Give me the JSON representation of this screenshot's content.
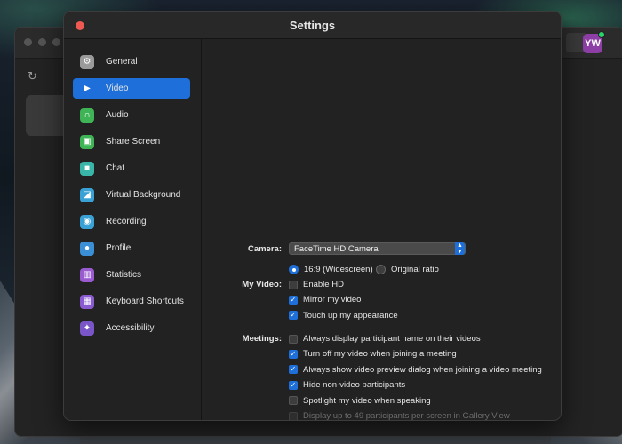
{
  "settings": {
    "title": "Settings"
  },
  "background_app": {
    "avatar_initials": "YW"
  },
  "sidebar": {
    "items": [
      {
        "label": "General",
        "icon": "gear-icon",
        "color": "#9a9a9a",
        "glyph": "⚙"
      },
      {
        "label": "Video",
        "icon": "video-camera-icon",
        "color": "#1e6fd9",
        "glyph": "▶",
        "active": true
      },
      {
        "label": "Audio",
        "icon": "headphones-icon",
        "color": "#3fb457",
        "glyph": "∩"
      },
      {
        "label": "Share Screen",
        "icon": "share-screen-icon",
        "color": "#3fb457",
        "glyph": "▣"
      },
      {
        "label": "Chat",
        "icon": "chat-icon",
        "color": "#39b6a8",
        "glyph": "■"
      },
      {
        "label": "Virtual Background",
        "icon": "person-background-icon",
        "color": "#3aa1d6",
        "glyph": "◪"
      },
      {
        "label": "Recording",
        "icon": "record-icon",
        "color": "#3aa1d6",
        "glyph": "◉"
      },
      {
        "label": "Profile",
        "icon": "person-icon",
        "color": "#3a8fd6",
        "glyph": "●"
      },
      {
        "label": "Statistics",
        "icon": "bar-chart-icon",
        "color": "#9a5bd0",
        "glyph": "▥"
      },
      {
        "label": "Keyboard Shortcuts",
        "icon": "keyboard-icon",
        "color": "#8a5bd0",
        "glyph": "▦"
      },
      {
        "label": "Accessibility",
        "icon": "accessibility-icon",
        "color": "#7a55c8",
        "glyph": "✦"
      }
    ]
  },
  "video": {
    "camera_label": "Camera:",
    "camera_value": "FaceTime HD Camera",
    "my_video_label": "My Video:",
    "aspect_options": [
      {
        "label": "16:9 (Widescreen)",
        "selected": true
      },
      {
        "label": "Original ratio",
        "selected": false
      }
    ],
    "my_video_options": [
      {
        "label": "Enable HD",
        "checked": false
      },
      {
        "label": "Mirror my video",
        "checked": true
      },
      {
        "label": "Touch up my appearance",
        "checked": true
      }
    ],
    "meetings_label": "Meetings:",
    "meetings_options": [
      {
        "label": "Always display participant name on their videos",
        "checked": false
      },
      {
        "label": "Turn off my video when joining a meeting",
        "checked": true
      },
      {
        "label": "Always show video preview dialog when joining a video meeting",
        "checked": true
      },
      {
        "label": "Hide non-video participants",
        "checked": true
      },
      {
        "label": "Spotlight my video when speaking",
        "checked": false
      },
      {
        "label": "Display up to 49 participants per screen in Gallery View",
        "checked": false,
        "disabled": true
      }
    ]
  },
  "colors": {
    "accent": "#1e6fd9",
    "close": "#ee5a52",
    "avatar": "#8e3fa6",
    "status_online": "#2bd46a"
  }
}
